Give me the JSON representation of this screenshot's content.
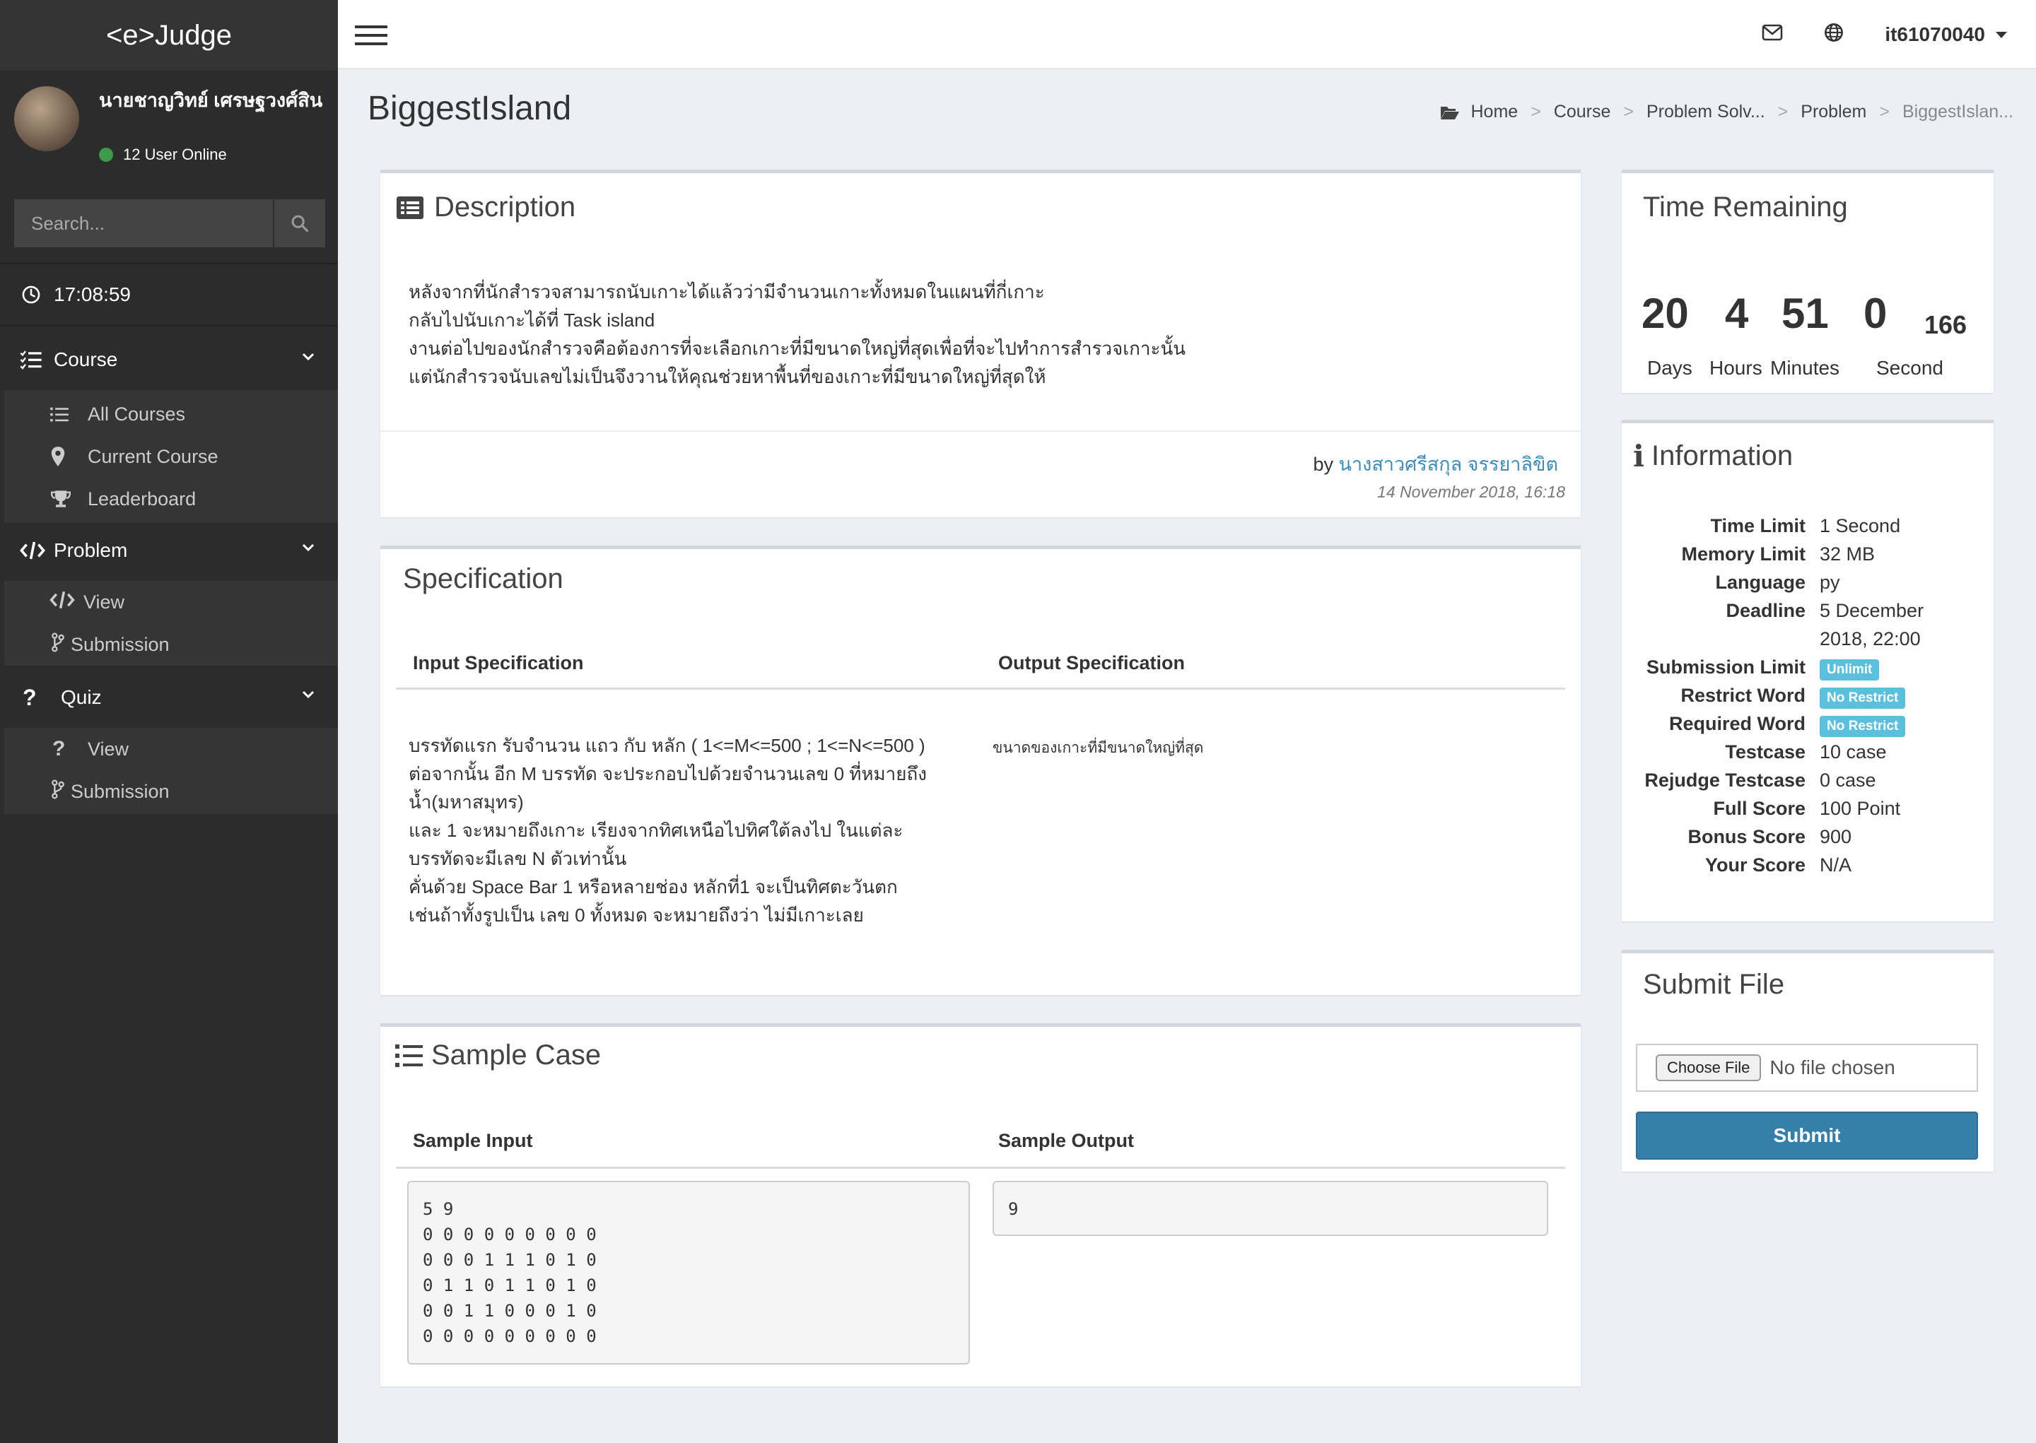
{
  "app": {
    "logo": "<e>Judge"
  },
  "user": {
    "name": "นายชาญวิทย์ เศรษฐวงศ์สิน",
    "online": "12 User Online",
    "username": "it61070040"
  },
  "search": {
    "placeholder": "Search..."
  },
  "clock": "17:08:59",
  "menu": {
    "course": {
      "label": "Course",
      "items": [
        "All Courses",
        "Current Course",
        "Leaderboard"
      ]
    },
    "problem": {
      "label": "Problem",
      "items": [
        "View",
        "Submission"
      ]
    },
    "quiz": {
      "label": "Quiz",
      "items": [
        "View",
        "Submission"
      ]
    }
  },
  "page": {
    "title": "BiggestIsland"
  },
  "breadcrumb": [
    "Home",
    "Course",
    "Problem Solv...",
    "Problem",
    "BiggestIslan..."
  ],
  "description": {
    "title": "Description",
    "lines": [
      "หลังจากที่นักสำรวจสามารถนับเกาะได้แล้วว่ามีจำนวนเกาะทั้งหมดในแผนที่กี่เกาะ",
      "กลับไปนับเกาะได้ที่ Task island",
      "งานต่อไปของนักสำรวจคือต้องการที่จะเลือกเกาะที่มีขนาดใหญ่ที่สุดเพื่อที่จะไปทำการสำรวจเกาะนั้น",
      "แต่นักสำรวจนับเลขไม่เป็นจึงวานให้คุณช่วยหาพื้นที่ของเกาะที่มีขนาดใหญ่ที่สุดให้"
    ],
    "by_prefix": "by",
    "author": "นางสาวศรีสกุล จรรยาลิขิต",
    "date": "14 November 2018, 16:18"
  },
  "specification": {
    "title": "Specification",
    "input_header": "Input Specification",
    "output_header": "Output Specification",
    "input_lines": [
      "บรรทัดแรก รับจำนวน แถว กับ หลัก ( 1<=M<=500 ; 1<=N<=500 )",
      "ต่อจากนั้น อีก M บรรทัด จะประกอบไปด้วยจำนวนเลข 0 ที่หมายถึง",
      "น้ำ(มหาสมุทร)",
      "และ 1 จะหมายถึงเกาะ เรียงจากทิศเหนือไปทิศใต้ลงไป ในแต่ละ",
      "บรรทัดจะมีเลข N ตัวเท่านั้น",
      "คั่นด้วย Space Bar 1 หรือหลายช่อง หลักที่1 จะเป็นทิศตะวันตก",
      "เช่นถ้าทั้งรูปเป็น เลข 0 ทั้งหมด จะหมายถึงว่า ไม่มีเกาะเลย"
    ],
    "output_text": "ขนาดของเกาะที่มีขนาดใหญ่ที่สุด"
  },
  "sample": {
    "title": "Sample Case",
    "input_header": "Sample Input",
    "output_header": "Sample Output",
    "input": "5 9\n0 0 0 0 0 0 0 0 0\n0 0 0 1 1 1 0 1 0\n0 1 1 0 1 1 0 1 0\n0 0 1 1 0 0 0 1 0\n0 0 0 0 0 0 0 0 0",
    "output": "9"
  },
  "time_remaining": {
    "title": "Time Remaining",
    "days": "20",
    "hours": "4",
    "minutes": "51",
    "seconds": "0",
    "extra": "166",
    "days_label": "Days",
    "hours_label": "Hours",
    "minutes_label": "Minutes",
    "seconds_label": "Second"
  },
  "information": {
    "title": "Information",
    "rows": [
      {
        "k": "Time Limit",
        "v": "1 Second"
      },
      {
        "k": "Memory Limit",
        "v": "32 MB"
      },
      {
        "k": "Language",
        "v": "py"
      },
      {
        "k": "Deadline",
        "v": "5 December"
      },
      {
        "k": "",
        "v": "2018, 22:00"
      },
      {
        "k": "Submission Limit",
        "v": "Unlimit"
      },
      {
        "k": "Restrict Word",
        "v": "No Restrict"
      },
      {
        "k": "Required Word",
        "v": "No Restrict"
      },
      {
        "k": "Testcase",
        "v": "10 case"
      },
      {
        "k": "Rejudge Testcase",
        "v": "0 case"
      },
      {
        "k": "Full Score",
        "v": "100 Point"
      },
      {
        "k": "Bonus Score",
        "v": "900"
      },
      {
        "k": "Your Score",
        "v": "N/A"
      }
    ]
  },
  "submit_file": {
    "title": "Submit File",
    "choose_label": "Choose File",
    "no_file": "No file chosen",
    "submit_label": "Submit"
  },
  "colors": {
    "sidebar": "#2c2c2c",
    "link": "#3c8dbc",
    "submit": "#367fa9",
    "badge": "#5bc0de"
  }
}
